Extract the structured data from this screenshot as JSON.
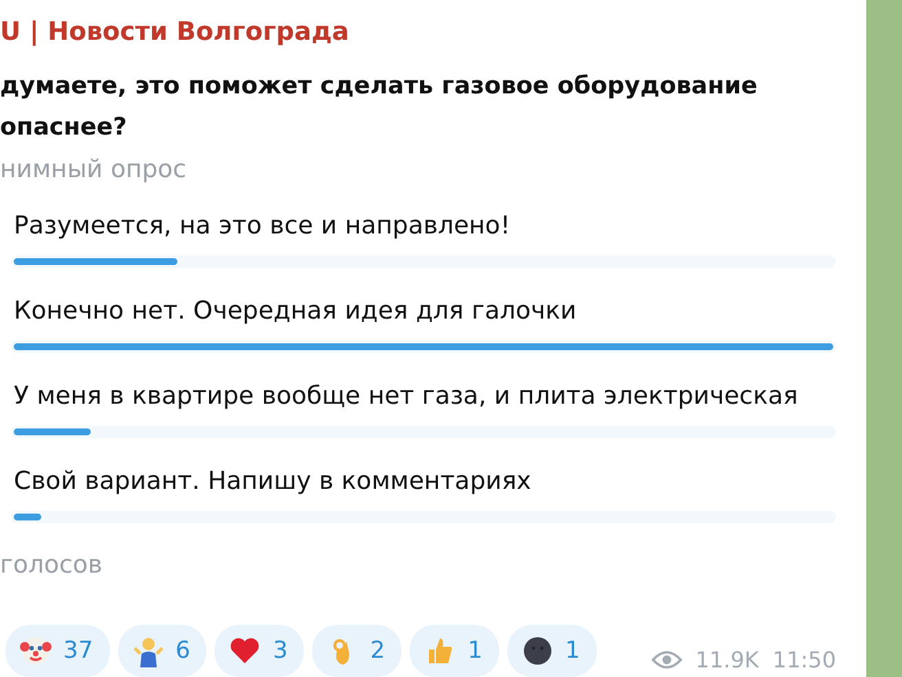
{
  "channel": {
    "name": "U | Новости Волгограда"
  },
  "poll": {
    "question": "думаете, это поможет сделать газовое оборудование опаснее?",
    "type": "нимный опрос",
    "options": [
      {
        "text": "Разумеется, на это все и направлено!",
        "level": 0.2
      },
      {
        "text": "Конечно нет. Очередная идея для галочки",
        "level": 1
      },
      {
        "text": "У меня в квартире вообще нет газа, и плита электрическая",
        "level": 0.094
      },
      {
        "text": "Свой вариант. Напишу в комментариях",
        "level": 0.034
      }
    ],
    "votes": "голосов"
  },
  "reactions": [
    {
      "kind": "clown",
      "count": "37"
    },
    {
      "kind": "shrug",
      "count": "6"
    },
    {
      "kind": "heart",
      "count": "3"
    },
    {
      "kind": "ok",
      "count": "2"
    },
    {
      "kind": "thumb",
      "count": "1"
    },
    {
      "kind": "moon",
      "count": "1"
    }
  ],
  "views": "11.9K",
  "time": "11:50"
}
